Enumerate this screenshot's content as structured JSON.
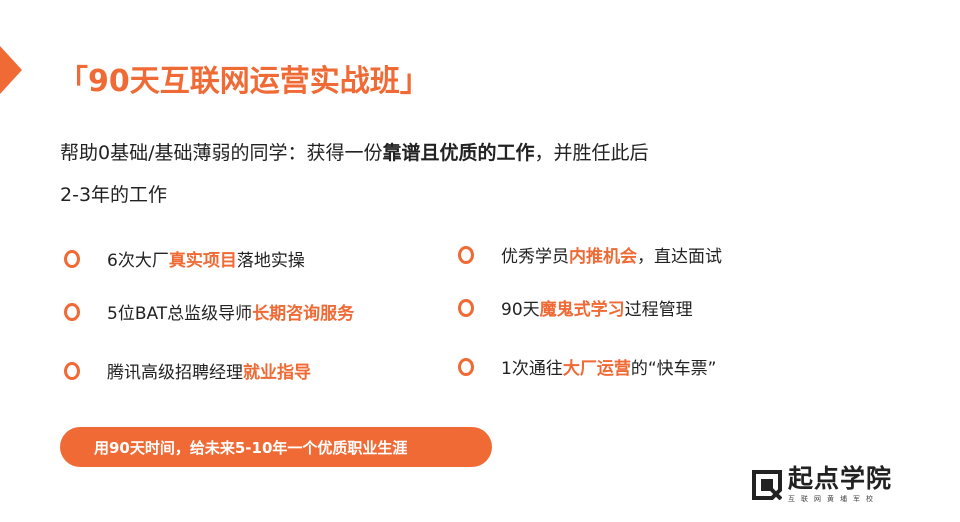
{
  "title": "「90天互联网运营实战班」",
  "subtitle": {
    "line1_pre": "帮助0基础/基础薄弱的同学：获得一份",
    "line1_bold": "靠谱且优质的工作",
    "line1_post": "，并胜任此后",
    "line2": "2-3年的工作"
  },
  "left_items": [
    {
      "pre": "6次大厂",
      "hl": "真实项目",
      "post": "落地实操"
    },
    {
      "pre": "5位BAT总监级导师",
      "hl": "长期咨询服务",
      "post": ""
    },
    {
      "pre": "腾讯高级招聘经理",
      "hl": "就业指导",
      "post": ""
    }
  ],
  "right_items": [
    {
      "pre": "优秀学员",
      "hl": "内推机会",
      "post": "，直达面试"
    },
    {
      "pre": "90天",
      "hl": "魔鬼式学习",
      "post": "过程管理"
    },
    {
      "pre": "1次通往",
      "hl": "大厂运营",
      "post": "的“快车票”"
    }
  ],
  "banner": "用90天时间，给未来5-10年一个优质职业生涯",
  "logo": {
    "name": "起点学院",
    "sub": "互联网黄埔军校",
    "icon": "qidian-logo-icon"
  },
  "colors": {
    "accent": "#ef6a35",
    "text": "#222222",
    "background": "#ffffff"
  }
}
